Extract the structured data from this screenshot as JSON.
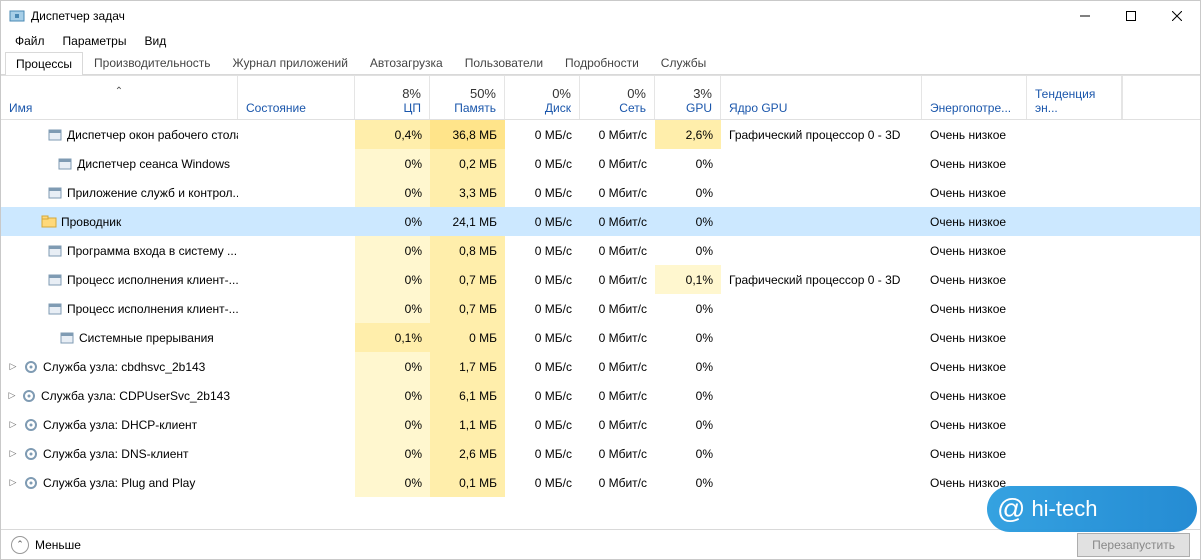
{
  "window": {
    "title": "Диспетчер задач"
  },
  "menu": [
    "Файл",
    "Параметры",
    "Вид"
  ],
  "tabs": [
    "Процессы",
    "Производительность",
    "Журнал приложений",
    "Автозагрузка",
    "Пользователи",
    "Подробности",
    "Службы"
  ],
  "active_tab": 0,
  "columns": {
    "name": "Имя",
    "status": "Состояние",
    "cpu": {
      "usage": "8%",
      "label": "ЦП"
    },
    "mem": {
      "usage": "50%",
      "label": "Память"
    },
    "disk": {
      "usage": "0%",
      "label": "Диск"
    },
    "net": {
      "usage": "0%",
      "label": "Сеть"
    },
    "gpu": {
      "usage": "3%",
      "label": "GPU"
    },
    "gpu_core": "Ядро GPU",
    "power": "Энергопотре...",
    "trend": "Тенденция эн..."
  },
  "rows": [
    {
      "icon": "window",
      "name": "Диспетчер окон рабочего стола",
      "cpu": "0,4%",
      "cpu_h": "mid",
      "mem": "36,8 МБ",
      "mem_h": "hi",
      "disk": "0 МБ/с",
      "net": "0 Мбит/с",
      "gpu": "2,6%",
      "gpu_h": "mid",
      "gpuc": "Графический процессор 0 - 3D",
      "power": "Очень низкое",
      "indent": 2
    },
    {
      "icon": "window",
      "name": "Диспетчер сеанса  Windows",
      "cpu": "0%",
      "cpu_h": "low",
      "mem": "0,2 МБ",
      "mem_h": "mid",
      "disk": "0 МБ/с",
      "net": "0 Мбит/с",
      "gpu": "0%",
      "gpu_h": "",
      "gpuc": "",
      "power": "Очень низкое",
      "indent": 2
    },
    {
      "icon": "window",
      "name": "Приложение служб и контрол...",
      "cpu": "0%",
      "cpu_h": "low",
      "mem": "3,3 МБ",
      "mem_h": "mid",
      "disk": "0 МБ/с",
      "net": "0 Мбит/с",
      "gpu": "0%",
      "gpu_h": "",
      "gpuc": "",
      "power": "Очень низкое",
      "indent": 2
    },
    {
      "icon": "explorer",
      "name": "Проводник",
      "cpu": "0%",
      "cpu_h": "",
      "mem": "24,1 МБ",
      "mem_h": "",
      "disk": "0 МБ/с",
      "net": "0 Мбит/с",
      "gpu": "0%",
      "gpu_h": "",
      "gpuc": "",
      "power": "Очень низкое",
      "indent": 1,
      "selected": true
    },
    {
      "icon": "window",
      "name": "Программа входа в систему ...",
      "cpu": "0%",
      "cpu_h": "low",
      "mem": "0,8 МБ",
      "mem_h": "mid",
      "disk": "0 МБ/с",
      "net": "0 Мбит/с",
      "gpu": "0%",
      "gpu_h": "",
      "gpuc": "",
      "power": "Очень низкое",
      "indent": 2
    },
    {
      "icon": "window",
      "name": "Процесс исполнения клиент-...",
      "cpu": "0%",
      "cpu_h": "low",
      "mem": "0,7 МБ",
      "mem_h": "mid",
      "disk": "0 МБ/с",
      "net": "0 Мбит/с",
      "gpu": "0,1%",
      "gpu_h": "low",
      "gpuc": "Графический процессор 0 - 3D",
      "power": "Очень низкое",
      "indent": 2
    },
    {
      "icon": "window",
      "name": "Процесс исполнения клиент-...",
      "cpu": "0%",
      "cpu_h": "low",
      "mem": "0,7 МБ",
      "mem_h": "mid",
      "disk": "0 МБ/с",
      "net": "0 Мбит/с",
      "gpu": "0%",
      "gpu_h": "",
      "gpuc": "",
      "power": "Очень низкое",
      "indent": 2
    },
    {
      "icon": "window",
      "name": "Системные прерывания",
      "cpu": "0,1%",
      "cpu_h": "mid",
      "mem": "0 МБ",
      "mem_h": "mid",
      "disk": "0 МБ/с",
      "net": "0 Мбит/с",
      "gpu": "0%",
      "gpu_h": "",
      "gpuc": "",
      "power": "Очень низкое",
      "indent": 2
    },
    {
      "icon": "service",
      "name": "Служба узла: cbdhsvc_2b143",
      "cpu": "0%",
      "cpu_h": "low",
      "mem": "1,7 МБ",
      "mem_h": "mid",
      "disk": "0 МБ/с",
      "net": "0 Мбит/с",
      "gpu": "0%",
      "gpu_h": "",
      "gpuc": "",
      "power": "Очень низкое",
      "indent": 0,
      "expandable": true
    },
    {
      "icon": "service",
      "name": "Служба узла: CDPUserSvc_2b143",
      "cpu": "0%",
      "cpu_h": "low",
      "mem": "6,1 МБ",
      "mem_h": "mid",
      "disk": "0 МБ/с",
      "net": "0 Мбит/с",
      "gpu": "0%",
      "gpu_h": "",
      "gpuc": "",
      "power": "Очень низкое",
      "indent": 0,
      "expandable": true
    },
    {
      "icon": "service",
      "name": "Служба узла: DHCP-клиент",
      "cpu": "0%",
      "cpu_h": "low",
      "mem": "1,1 МБ",
      "mem_h": "mid",
      "disk": "0 МБ/с",
      "net": "0 Мбит/с",
      "gpu": "0%",
      "gpu_h": "",
      "gpuc": "",
      "power": "Очень низкое",
      "indent": 0,
      "expandable": true
    },
    {
      "icon": "service",
      "name": "Служба узла: DNS-клиент",
      "cpu": "0%",
      "cpu_h": "low",
      "mem": "2,6 МБ",
      "mem_h": "mid",
      "disk": "0 МБ/с",
      "net": "0 Мбит/с",
      "gpu": "0%",
      "gpu_h": "",
      "gpuc": "",
      "power": "Очень низкое",
      "indent": 0,
      "expandable": true
    },
    {
      "icon": "service",
      "name": "Служба узла: Plug and Play",
      "cpu": "0%",
      "cpu_h": "low",
      "mem": "0,1 МБ",
      "mem_h": "mid",
      "disk": "0 МБ/с",
      "net": "0 Мбит/с",
      "gpu": "0%",
      "gpu_h": "",
      "gpuc": "",
      "power": "Очень низкое",
      "indent": 0,
      "expandable": true
    }
  ],
  "statusbar": {
    "fewer": "Меньше",
    "restart": "Перезапустить"
  },
  "watermark": "hi-tech"
}
